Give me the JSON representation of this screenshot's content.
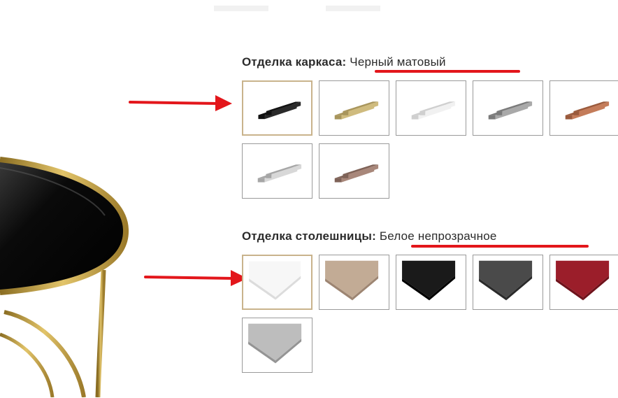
{
  "frame_finish": {
    "label": "Отделка каркаса",
    "separator": ":",
    "selected_value": "Черный матовый",
    "options": [
      {
        "name": "black-matte",
        "color": "#2a2a2a",
        "shade": "#111111",
        "selected": true
      },
      {
        "name": "brass",
        "color": "#cfbb7e",
        "shade": "#a8955c",
        "selected": false
      },
      {
        "name": "white",
        "color": "#f1f1f1",
        "shade": "#cfcfcf",
        "selected": false
      },
      {
        "name": "gray",
        "color": "#a9a9a9",
        "shade": "#7a7a7a",
        "selected": false
      },
      {
        "name": "copper",
        "color": "#c47c5a",
        "shade": "#9a5a3c",
        "selected": false
      },
      {
        "name": "silver",
        "color": "#d8d8d8",
        "shade": "#a6a6a6",
        "selected": false
      },
      {
        "name": "bronze",
        "color": "#a8877a",
        "shade": "#7e6257",
        "selected": false
      }
    ]
  },
  "top_finish": {
    "label": "Отделка столешницы",
    "separator": ":",
    "selected_value": "Белое непрозрачное",
    "options": [
      {
        "name": "white-opaque",
        "color": "#f7f7f7",
        "shade": "#dcdcdc",
        "selected": true
      },
      {
        "name": "bronze-glass",
        "color": "#c2ab95",
        "shade": "#9d8572",
        "selected": false
      },
      {
        "name": "black-glass",
        "color": "#1a1a1a",
        "shade": "#000000",
        "selected": false
      },
      {
        "name": "graphite-glass",
        "color": "#4a4a4a",
        "shade": "#2a2a2a",
        "selected": false
      },
      {
        "name": "red-glass",
        "color": "#9b1e2a",
        "shade": "#6f121b",
        "selected": false
      },
      {
        "name": "silver-glass",
        "color": "#bdbdbd",
        "shade": "#949494",
        "selected": false
      }
    ]
  },
  "colors": {
    "accent_underline": "#e3161b",
    "arrow": "#e3161b",
    "selected_border": "#c9b38c",
    "table_frame": "#c9a640"
  }
}
